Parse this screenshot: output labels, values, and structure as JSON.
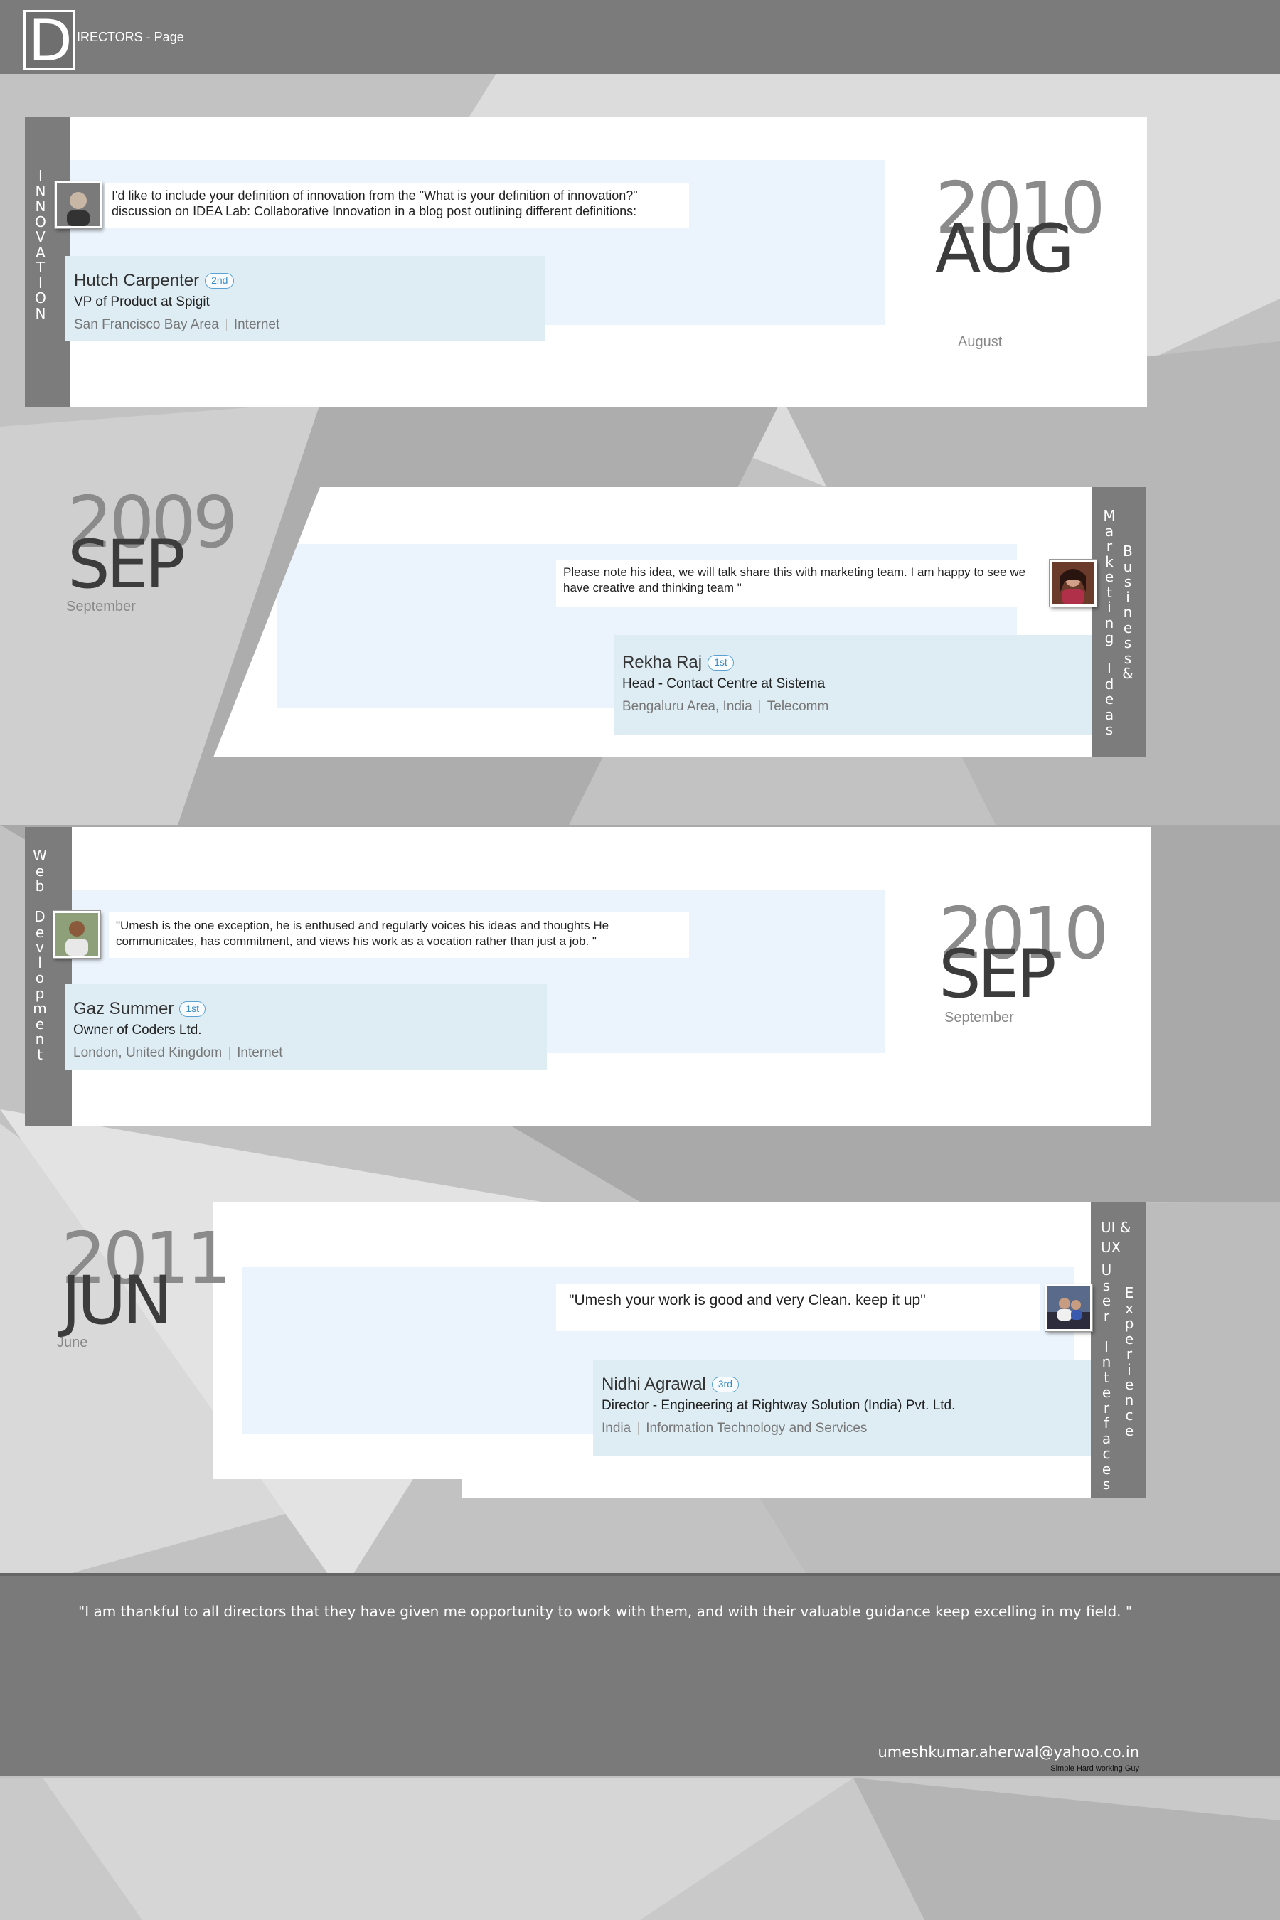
{
  "header": {
    "logo_letter": "D",
    "title": "IRECTORS - Page"
  },
  "entries": [
    {
      "tag_letters": [
        "I",
        "N",
        "N",
        "O",
        "V",
        "A",
        "T",
        "I",
        "O",
        "N"
      ],
      "quote": "I'd like to include your definition of innovation from the \"What is your definition of innovation?\" discussion on IDEA Lab: Collaborative Innovation in a blog post outlining different definitions:",
      "name": "Hutch Carpenter",
      "degree": "2nd",
      "title": "VP of Product at Spigit",
      "location": "San Francisco Bay Area",
      "industry": "Internet",
      "year": "2010",
      "month": "AUG",
      "month_full": "August"
    },
    {
      "tag_col1": [
        "M",
        "a",
        "r",
        "k",
        "e",
        "t",
        "i",
        "n",
        "g",
        "",
        "I",
        "d",
        "e",
        "a",
        "s"
      ],
      "tag_col2": [
        "B",
        "u",
        "s",
        "i",
        "n",
        "e",
        "s",
        "s",
        "&"
      ],
      "quote": "Please note his idea, we will talk share this with marketing team. I am happy to see we have creative and thinking team \"",
      "name": "Rekha Raj",
      "degree": "1st",
      "title": "Head - Contact Centre at Sistema",
      "location": "Bengaluru Area, India",
      "industry": "Telecomm",
      "year": "2009",
      "month": "SEP",
      "month_full": "September"
    },
    {
      "tag_col1": [
        "W",
        "e",
        "b",
        "",
        "D",
        "e",
        "v",
        "l",
        "o",
        "p",
        "m",
        "e",
        "n",
        "t"
      ],
      "quote": "\"Umesh is the one exception, he is enthused and regularly voices his ideas and thoughts He communicates, has commitment, and views his work as a vocation rather than just a job. \"",
      "name": "Gaz Summer",
      "degree": "1st",
      "title": "Owner of Coders Ltd.",
      "location": "London, United Kingdom",
      "industry": "Internet",
      "year": "2010",
      "month": "SEP",
      "month_full": "September"
    },
    {
      "tag_label": "UI & UX",
      "tag_col1": [
        "U",
        "s",
        "e",
        "r",
        "",
        "I",
        "n",
        "t",
        "e",
        "r",
        "f",
        "a",
        "c",
        "e",
        "s"
      ],
      "tag_col2": [
        "E",
        "x",
        "p",
        "e",
        "r",
        "i",
        "e",
        "n",
        "c",
        "e"
      ],
      "quote": "\"Umesh your work is good and very Clean. keep it up\"",
      "name": "Nidhi Agrawal",
      "degree": "3rd",
      "title": "Director - Engineering at Rightway Solution (India) Pvt. Ltd.",
      "location": "India",
      "industry": "Information Technology and Services",
      "year": "2011",
      "month": "JUN",
      "month_full": "June"
    }
  ],
  "footer": {
    "quote": "\"I am thankful to all directors that they have given me opportunity to work with them, and with their valuable guidance keep excelling in my field.  \"",
    "email": "umeshkumar.aherwal@yahoo.co.in",
    "tagline": "Simple Hard working Guy"
  }
}
